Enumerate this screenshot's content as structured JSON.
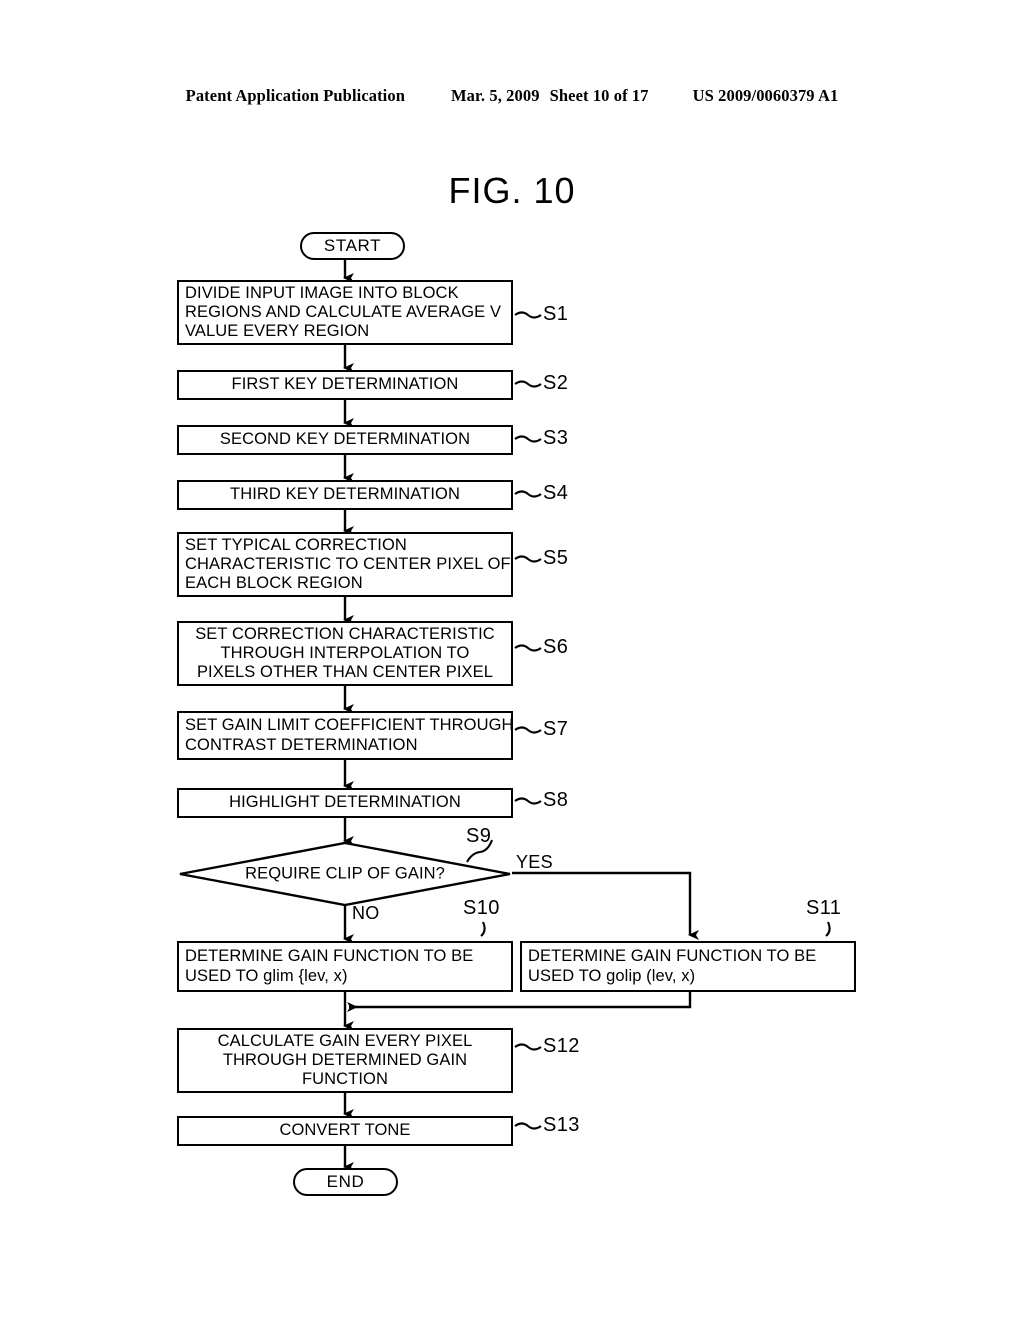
{
  "header": {
    "publication": "Patent Application Publication",
    "date": "Mar. 5, 2009",
    "sheet": "Sheet 10 of 17",
    "number": "US 2009/0060379 A1"
  },
  "figure": {
    "title": "FIG. 10"
  },
  "flow": {
    "start_label": "START",
    "end_label": "END",
    "branch_yes": "YES",
    "branch_no": "NO",
    "decision": {
      "ref": "S9",
      "text": "REQUIRE CLIP OF GAIN?"
    },
    "steps": [
      {
        "ref": "S1",
        "align": "left",
        "lines": [
          "DIVIDE INPUT IMAGE INTO BLOCK",
          "REGIONS AND CALCULATE AVERAGE V",
          "VALUE EVERY REGION"
        ]
      },
      {
        "ref": "S2",
        "align": "center",
        "lines": [
          "FIRST KEY DETERMINATION"
        ]
      },
      {
        "ref": "S3",
        "align": "center",
        "lines": [
          "SECOND KEY DETERMINATION"
        ]
      },
      {
        "ref": "S4",
        "align": "center",
        "lines": [
          "THIRD KEY DETERMINATION"
        ]
      },
      {
        "ref": "S5",
        "align": "left",
        "lines": [
          "SET TYPICAL CORRECTION",
          "CHARACTERISTIC TO CENTER PIXEL OF",
          "EACH BLOCK REGION"
        ]
      },
      {
        "ref": "S6",
        "align": "center",
        "lines": [
          "SET CORRECTION CHARACTERISTIC",
          "THROUGH INTERPOLATION TO",
          "PIXELS OTHER THAN CENTER PIXEL"
        ]
      },
      {
        "ref": "S7",
        "align": "left",
        "lines": [
          "SET GAIN LIMIT COEFFICIENT THROUGH",
          "CONTRAST DETERMINATION"
        ]
      },
      {
        "ref": "S8",
        "align": "center",
        "lines": [
          "HIGHLIGHT DETERMINATION"
        ]
      },
      {
        "ref": "S10",
        "align": "left",
        "lines": [
          "DETERMINE GAIN FUNCTION TO BE",
          "USED TO glim {lev, x)"
        ]
      },
      {
        "ref": "S11",
        "align": "left",
        "lines": [
          "DETERMINE GAIN FUNCTION TO BE",
          "USED TO golip (lev, x)"
        ]
      },
      {
        "ref": "S12",
        "align": "center",
        "lines": [
          "CALCULATE GAIN EVERY PIXEL",
          "THROUGH DETERMINED GAIN",
          "FUNCTION"
        ]
      },
      {
        "ref": "S13",
        "align": "center",
        "lines": [
          "CONVERT TONE"
        ]
      }
    ]
  },
  "colors": {
    "ink": "#000000",
    "paper": "#ffffff"
  }
}
